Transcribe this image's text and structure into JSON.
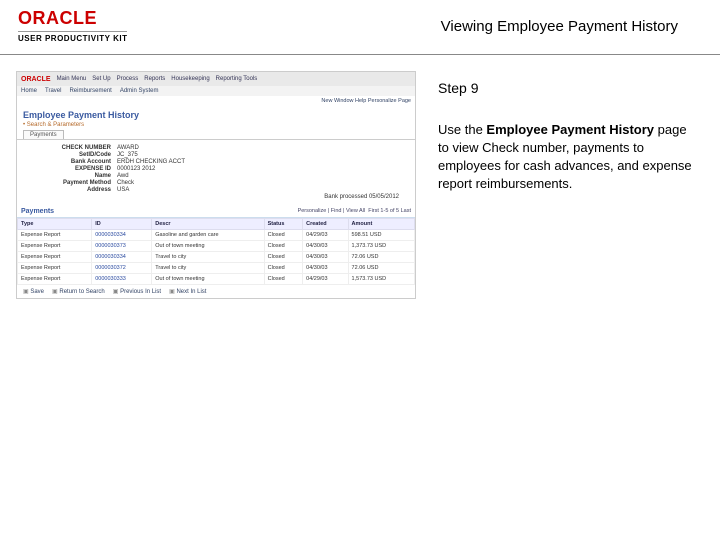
{
  "header": {
    "brand_main": "ORACLE",
    "brand_sub": "USER PRODUCTIVITY KIT",
    "title": "Viewing Employee Payment History"
  },
  "right": {
    "step": "Step 9",
    "instr_pre": "Use the ",
    "instr_bold": "Employee Payment History",
    "instr_post": " page to view Check number, payments to employees for cash advances, and expense report reimbursements."
  },
  "app": {
    "brand": "ORACLE",
    "menu_primary": [
      "Main Menu",
      "Set Up",
      "Process",
      "Reports",
      "Housekeeping",
      "Reporting Tools"
    ],
    "menu_secondary": [
      "Home",
      "Travel",
      "Reimbursement",
      "Admin System"
    ],
    "subbar": "New Window  Help  Personalize Page",
    "page_title": "Employee Payment History",
    "sub_link": "• Search & Parameters",
    "tab": "Payments",
    "details": {
      "check_number": "CHECK NUMBER",
      "check_number_v": "AWARD",
      "setid": "SetID/Code",
      "setid_v": "JC_375",
      "bank_account": "Bank Account",
      "bank_account_v": "ERDH CHECKING ACCT",
      "expense_id": "EXPENSE ID",
      "expense_id_v": "0000123  2012",
      "name": "Name",
      "name_v": "Awd",
      "payment_method": "Payment Method",
      "payment_method_v": "Check",
      "address": "Address",
      "address_v": "USA"
    },
    "section_title": "Payments",
    "section_meta_left": "Personalize | Find | View All",
    "section_meta_right": "First  1-5 of 5  Last",
    "bank_processed": "Bank processed  05/05/2012",
    "columns": [
      "Type",
      "ID",
      "Descr",
      "Status",
      "Created",
      "Amount"
    ],
    "rows": [
      {
        "type": "Expense Report",
        "id": "0000030334",
        "descr": "Gasoline and garden care",
        "status": "Closed",
        "created": "04/29/03",
        "amount": "598.51 USD"
      },
      {
        "type": "Expense Report",
        "id": "0000030373",
        "descr": "Out of town meeting",
        "status": "Closed",
        "created": "04/30/03",
        "amount": "1,373.73 USD"
      },
      {
        "type": "Expense Report",
        "id": "0000030334",
        "descr": "Travel to city",
        "status": "Closed",
        "created": "04/30/03",
        "amount": "72.06 USD"
      },
      {
        "type": "Expense Report",
        "id": "0000030372",
        "descr": "Travel to city",
        "status": "Closed",
        "created": "04/30/03",
        "amount": "72.06 USD"
      },
      {
        "type": "Expense Report",
        "id": "0000030333",
        "descr": "Out of town meeting",
        "status": "Closed",
        "created": "04/29/03",
        "amount": "1,573.73 USD"
      }
    ],
    "footer_links": [
      "Save",
      "Return to Search",
      "Previous In List",
      "Next In List"
    ]
  }
}
